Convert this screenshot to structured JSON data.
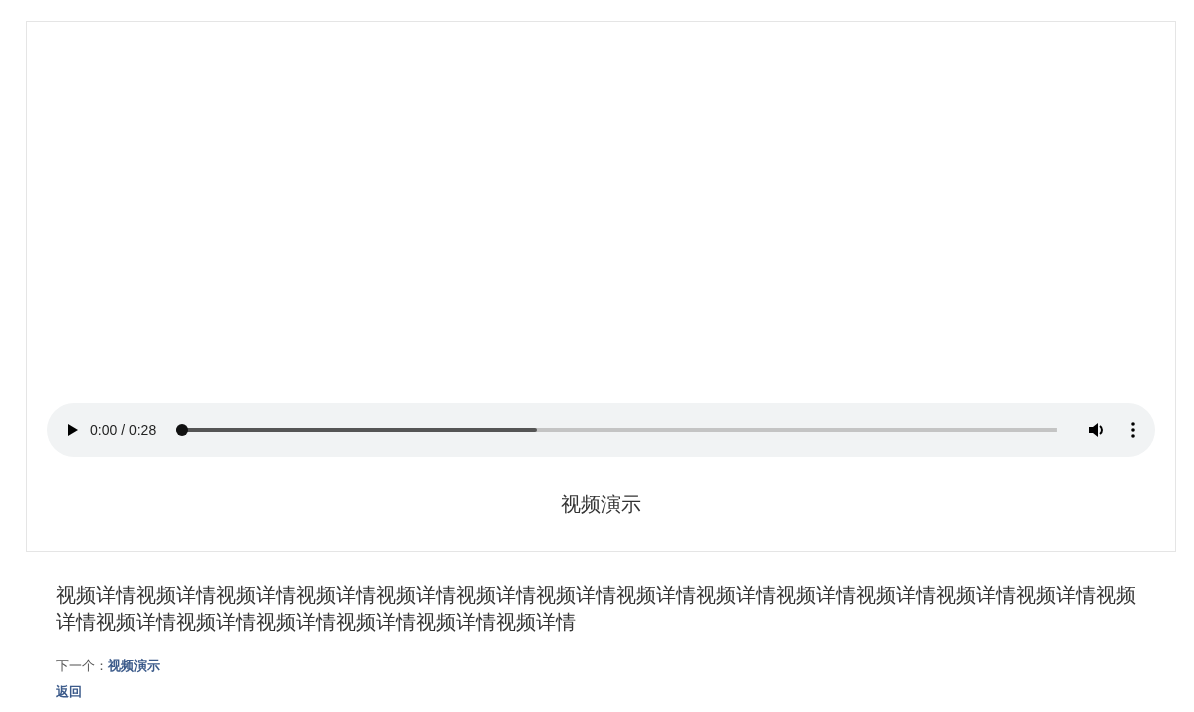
{
  "player": {
    "time": "0:00 / 0:28",
    "progress": {
      "level": 0
    },
    "buffered": {
      "level": 0.41
    }
  },
  "caption": "视频演示",
  "description": "视频详情视频详情视频详情视频详情视频详情视频详情视频详情视频详情视频详情视频详情视频详情视频详情视频详情视频详情视频详情视频详情视频详情视频详情视频详情视频详情",
  "next": {
    "label": "下一个：",
    "link": "视频演示"
  },
  "back": "返回"
}
